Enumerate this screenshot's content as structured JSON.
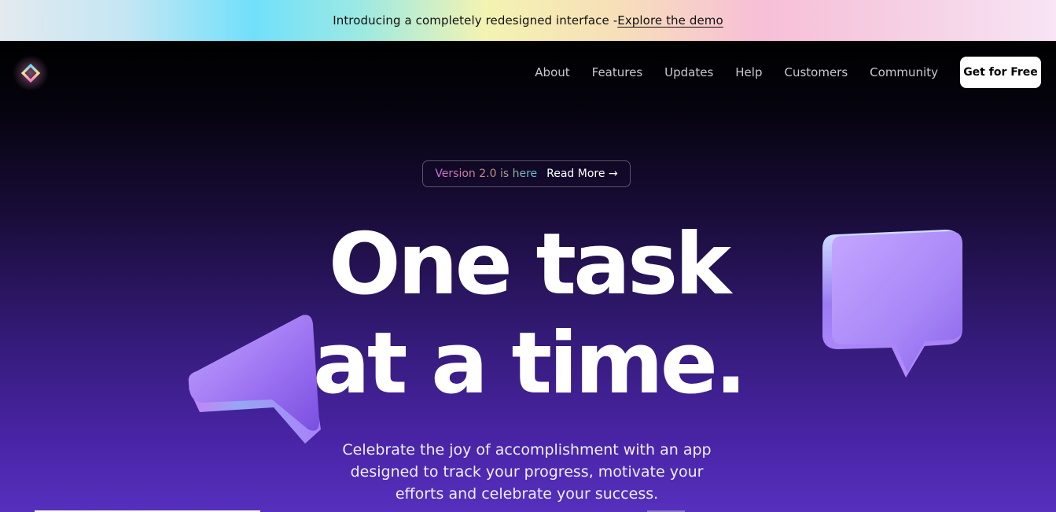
{
  "announcement": {
    "text": "Introducing a completely redesigned interface - ",
    "link": "Explore the demo"
  },
  "nav": {
    "items": [
      {
        "label": "About"
      },
      {
        "label": "Features"
      },
      {
        "label": "Updates"
      },
      {
        "label": "Help"
      },
      {
        "label": "Customers"
      },
      {
        "label": "Community"
      }
    ],
    "cta_label": "Get for Free"
  },
  "hero": {
    "badge_version": "Version 2.0 is here",
    "badge_link": "Read More",
    "badge_arrow": "→",
    "headline_line1": "One task",
    "headline_line2": "at a time.",
    "subtitle": "Celebrate the joy of accomplishment with an app designed to track your progress, motivate your efforts and celebrate your success."
  },
  "icons": {
    "logo": "diamond-logo-icon",
    "cursor_decoration": "cursor-arrow-3d-icon",
    "chat_decoration": "chat-bubble-3d-icon"
  },
  "colors": {
    "accent_purple": "#5630bd",
    "cta_background": "#ffffff"
  }
}
